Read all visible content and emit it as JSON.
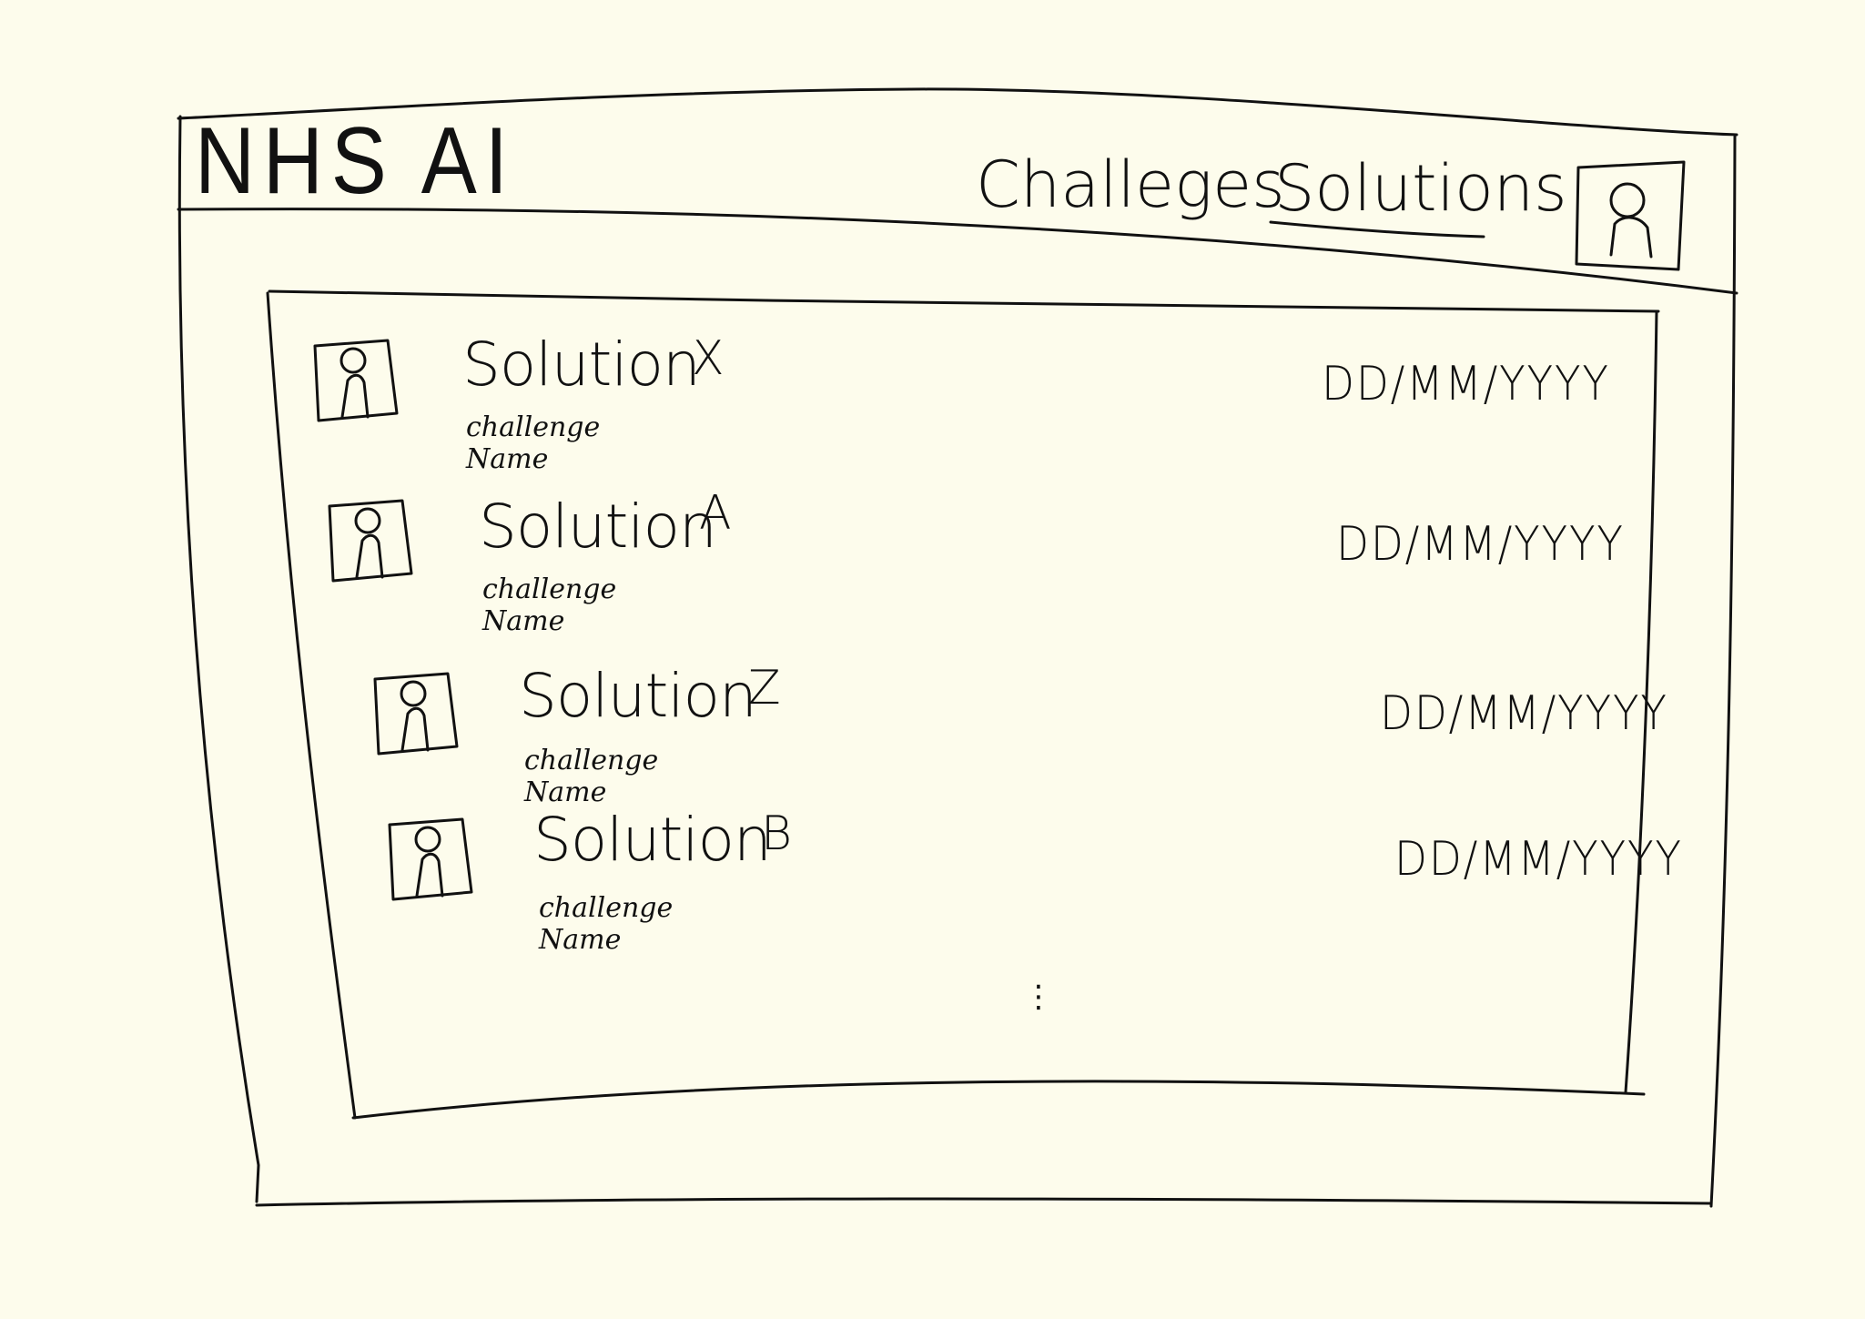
{
  "header": {
    "logo": "NHS AI",
    "nav": {
      "challenges_label": "Challeges",
      "solutions_label": "Solutions"
    },
    "profile_icon": "user-avatar-icon"
  },
  "solutions_list": {
    "items": [
      {
        "title": "Solution",
        "suffix": "X",
        "challenge": "challenge Name",
        "date": "DD/MM/YYYY",
        "icon": "user-avatar-icon"
      },
      {
        "title": "Solution",
        "suffix": "A",
        "challenge": "challenge Name",
        "date": "DD/MM/YYYY",
        "icon": "user-avatar-icon"
      },
      {
        "title": "Solution",
        "suffix": "Z",
        "challenge": "challenge Name",
        "date": "DD/MM/YYYY",
        "icon": "user-avatar-icon"
      },
      {
        "title": "Solution",
        "suffix": "B",
        "challenge": "challenge Name",
        "date": "DD/MM/YYYY",
        "icon": "user-avatar-icon"
      }
    ],
    "more_indicator": ":"
  },
  "colors": {
    "background": "#fdfcec",
    "ink": "#111111"
  }
}
